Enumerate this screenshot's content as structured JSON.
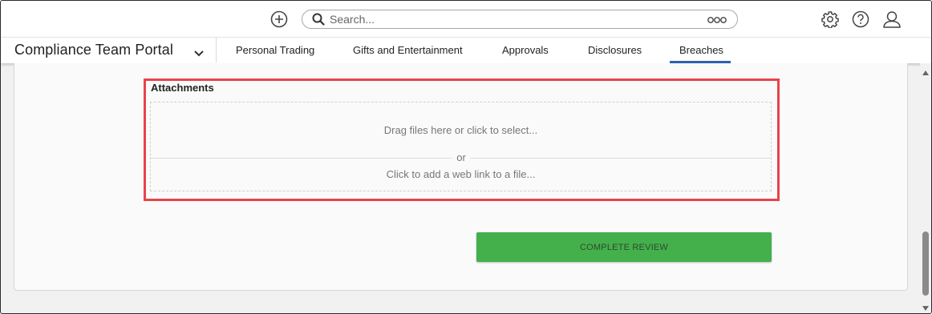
{
  "topbar": {
    "add_icon": "plus-circle-icon",
    "search": {
      "placeholder": "Search...",
      "value": ""
    },
    "icons": [
      "gear-icon",
      "help-icon",
      "user-icon"
    ]
  },
  "navbar": {
    "portal_title": "Compliance Team Portal",
    "tabs": [
      {
        "label": "Personal Trading"
      },
      {
        "label": "Gifts and Entertainment"
      },
      {
        "label": "Approvals"
      },
      {
        "label": "Disclosures"
      },
      {
        "label": "Breaches",
        "active": true
      }
    ]
  },
  "attachments": {
    "title": "Attachments",
    "drop_text": "Drag files here or click to select...",
    "or_text": "or",
    "link_text": "Click to add a web link to a file..."
  },
  "actions": {
    "complete_label": "COMPLETE REVIEW"
  },
  "colors": {
    "accent": "#2e5fb8",
    "complete_button": "#44b04b",
    "highlight": "#e8434a"
  }
}
